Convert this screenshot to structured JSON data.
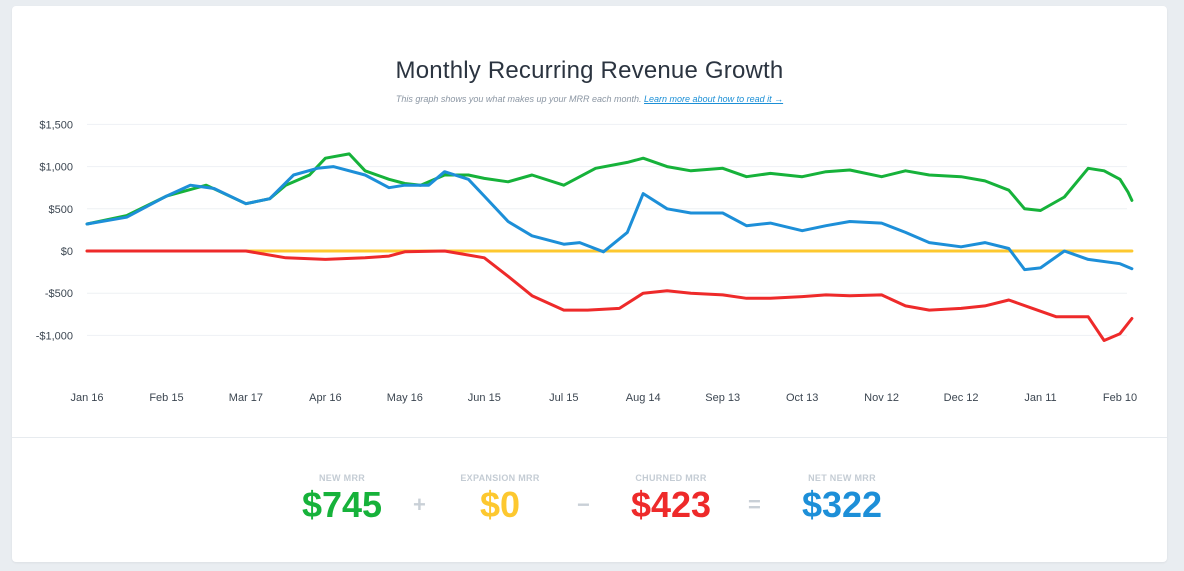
{
  "header": {
    "title": "Monthly Recurring Revenue Growth",
    "subtitle": "This graph shows you what makes up your MRR each month.",
    "learn_more": "Learn more about how to read it →"
  },
  "colors": {
    "new": "#16b23a",
    "expansion": "#fdc82f",
    "churned": "#ee2a2a",
    "net": "#1d8fd8"
  },
  "chart_data": {
    "type": "line",
    "title": "Monthly Recurring Revenue Growth",
    "ylim": [
      -1500,
      1500
    ],
    "y_ticks": [
      1500,
      1000,
      500,
      0,
      -500,
      -1000
    ],
    "y_tick_labels": [
      "$1,500",
      "$1,000",
      "$500",
      "$0",
      "-$500",
      "-$1,000"
    ],
    "x_labels": [
      "Jan 16",
      "Feb 15",
      "Mar 17",
      "Apr 16",
      "May 16",
      "Jun 15",
      "Jul 15",
      "Aug 14",
      "Sep 13",
      "Oct 13",
      "Nov 12",
      "Dec 12",
      "Jan 11",
      "Feb 10"
    ],
    "grid": true,
    "series": [
      {
        "name": "New MRR",
        "key": "new",
        "points": [
          [
            0,
            320
          ],
          [
            0.5,
            420
          ],
          [
            1,
            650
          ],
          [
            1.5,
            780
          ],
          [
            2,
            560
          ],
          [
            2.3,
            620
          ],
          [
            2.5,
            780
          ],
          [
            2.8,
            900
          ],
          [
            3,
            1100
          ],
          [
            3.3,
            1150
          ],
          [
            3.5,
            950
          ],
          [
            3.8,
            850
          ],
          [
            4,
            800
          ],
          [
            4.2,
            780
          ],
          [
            4.5,
            900
          ],
          [
            4.8,
            900
          ],
          [
            5,
            860
          ],
          [
            5.3,
            820
          ],
          [
            5.6,
            900
          ],
          [
            6,
            780
          ],
          [
            6.4,
            980
          ],
          [
            6.8,
            1050
          ],
          [
            7,
            1100
          ],
          [
            7.3,
            1000
          ],
          [
            7.6,
            950
          ],
          [
            8,
            980
          ],
          [
            8.3,
            880
          ],
          [
            8.6,
            920
          ],
          [
            9,
            880
          ],
          [
            9.3,
            940
          ],
          [
            9.6,
            960
          ],
          [
            10,
            880
          ],
          [
            10.3,
            950
          ],
          [
            10.6,
            900
          ],
          [
            11,
            880
          ],
          [
            11.3,
            830
          ],
          [
            11.6,
            720
          ],
          [
            11.8,
            500
          ],
          [
            12,
            480
          ],
          [
            12.3,
            640
          ],
          [
            12.6,
            980
          ],
          [
            12.8,
            950
          ],
          [
            13,
            850
          ],
          [
            13.1,
            700
          ],
          [
            13.15,
            600
          ]
        ]
      },
      {
        "name": "Expansion MRR",
        "key": "expansion",
        "points": [
          [
            0,
            0
          ],
          [
            13.15,
            0
          ]
        ]
      },
      {
        "name": "Churned MRR",
        "key": "churned",
        "points": [
          [
            0,
            0
          ],
          [
            2,
            0
          ],
          [
            2.5,
            -80
          ],
          [
            3,
            -100
          ],
          [
            3.5,
            -80
          ],
          [
            3.8,
            -60
          ],
          [
            4,
            -10
          ],
          [
            4.5,
            0
          ],
          [
            5,
            -80
          ],
          [
            5.3,
            -300
          ],
          [
            5.6,
            -530
          ],
          [
            6,
            -700
          ],
          [
            6.3,
            -700
          ],
          [
            6.7,
            -680
          ],
          [
            7,
            -500
          ],
          [
            7.3,
            -470
          ],
          [
            7.6,
            -500
          ],
          [
            8,
            -520
          ],
          [
            8.3,
            -560
          ],
          [
            8.6,
            -560
          ],
          [
            9,
            -540
          ],
          [
            9.3,
            -520
          ],
          [
            9.6,
            -530
          ],
          [
            10,
            -520
          ],
          [
            10.3,
            -650
          ],
          [
            10.6,
            -700
          ],
          [
            11,
            -680
          ],
          [
            11.3,
            -650
          ],
          [
            11.6,
            -580
          ],
          [
            11.9,
            -680
          ],
          [
            12.2,
            -780
          ],
          [
            12.6,
            -780
          ],
          [
            12.8,
            -1060
          ],
          [
            13,
            -980
          ],
          [
            13.15,
            -800
          ]
        ]
      },
      {
        "name": "Net New MRR",
        "key": "net",
        "points": [
          [
            0,
            320
          ],
          [
            0.5,
            400
          ],
          [
            1,
            650
          ],
          [
            1.3,
            780
          ],
          [
            1.6,
            740
          ],
          [
            2,
            560
          ],
          [
            2.3,
            620
          ],
          [
            2.6,
            900
          ],
          [
            2.9,
            980
          ],
          [
            3.1,
            1000
          ],
          [
            3.5,
            900
          ],
          [
            3.8,
            750
          ],
          [
            4,
            780
          ],
          [
            4.3,
            780
          ],
          [
            4.5,
            940
          ],
          [
            4.8,
            850
          ],
          [
            5,
            650
          ],
          [
            5.3,
            350
          ],
          [
            5.6,
            180
          ],
          [
            6,
            80
          ],
          [
            6.2,
            100
          ],
          [
            6.5,
            -10
          ],
          [
            6.8,
            220
          ],
          [
            7,
            680
          ],
          [
            7.3,
            500
          ],
          [
            7.6,
            450
          ],
          [
            8,
            450
          ],
          [
            8.3,
            300
          ],
          [
            8.6,
            330
          ],
          [
            9,
            240
          ],
          [
            9.3,
            300
          ],
          [
            9.6,
            350
          ],
          [
            10,
            330
          ],
          [
            10.3,
            220
          ],
          [
            10.6,
            100
          ],
          [
            11,
            50
          ],
          [
            11.3,
            100
          ],
          [
            11.6,
            30
          ],
          [
            11.8,
            -220
          ],
          [
            12,
            -200
          ],
          [
            12.3,
            0
          ],
          [
            12.6,
            -100
          ],
          [
            13,
            -150
          ],
          [
            13.15,
            -210
          ]
        ]
      }
    ]
  },
  "metrics": {
    "new": {
      "label": "NEW MRR",
      "value": "$745"
    },
    "expansion": {
      "label": "EXPANSION MRR",
      "value": "$0"
    },
    "churned": {
      "label": "CHURNED MRR",
      "value": "$423"
    },
    "net": {
      "label": "NET NEW MRR",
      "value": "$322"
    }
  },
  "operators": {
    "plus": "+",
    "minus": "−",
    "equals": "="
  }
}
